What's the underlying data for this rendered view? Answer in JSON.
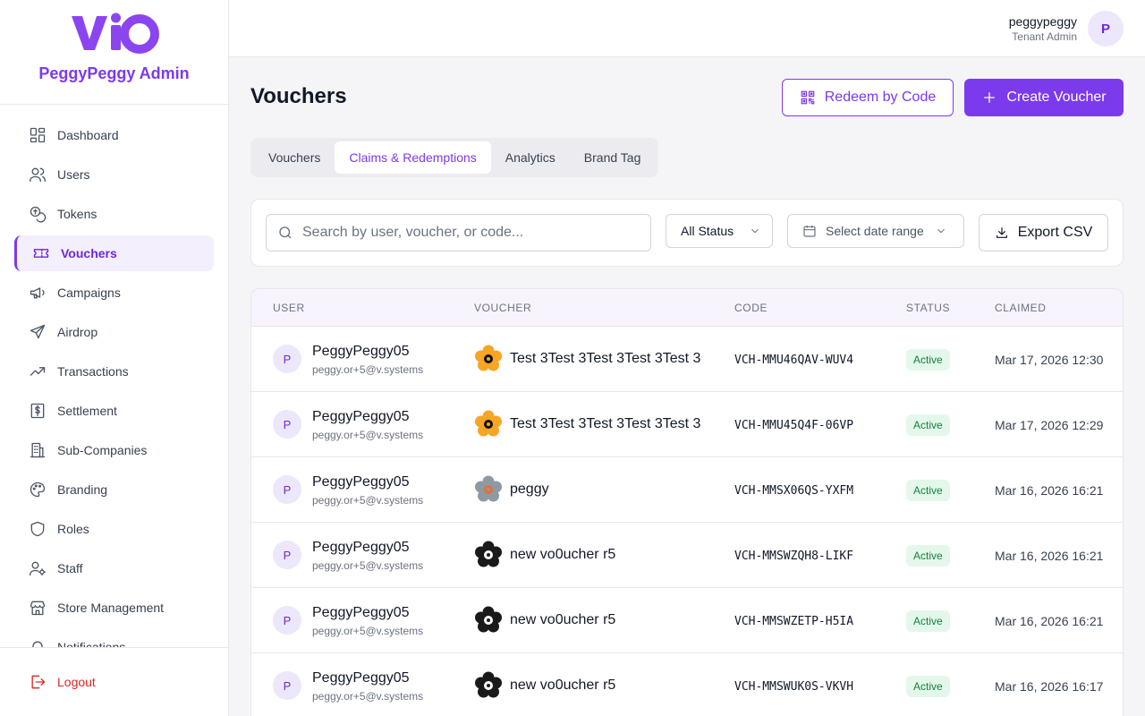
{
  "brand": {
    "logo_text": "VIO",
    "name": "PeggyPeggy Admin",
    "accent": "#7c3aed"
  },
  "nav": [
    {
      "label": "Dashboard",
      "icon": "dashboard-icon",
      "active": false
    },
    {
      "label": "Users",
      "icon": "users-icon",
      "active": false
    },
    {
      "label": "Tokens",
      "icon": "tokens-icon",
      "active": false
    },
    {
      "label": "Vouchers",
      "icon": "ticket-icon",
      "active": true
    },
    {
      "label": "Campaigns",
      "icon": "megaphone-icon",
      "active": false
    },
    {
      "label": "Airdrop",
      "icon": "send-icon",
      "active": false
    },
    {
      "label": "Transactions",
      "icon": "trending-up-icon",
      "active": false
    },
    {
      "label": "Settlement",
      "icon": "dollar-receipt-icon",
      "active": false
    },
    {
      "label": "Sub-Companies",
      "icon": "building-icon",
      "active": false
    },
    {
      "label": "Branding",
      "icon": "palette-icon",
      "active": false
    },
    {
      "label": "Roles",
      "icon": "shield-icon",
      "active": false
    },
    {
      "label": "Staff",
      "icon": "user-cog-icon",
      "active": false
    },
    {
      "label": "Store Management",
      "icon": "store-icon",
      "active": false
    },
    {
      "label": "Notifications",
      "icon": "bell-icon",
      "active": false
    }
  ],
  "logout_label": "Logout",
  "topbar": {
    "user_name": "peggypeggy",
    "user_role": "Tenant Admin",
    "avatar_initial": "P"
  },
  "page": {
    "title": "Vouchers",
    "redeem_label": "Redeem by Code",
    "create_label": "Create Voucher"
  },
  "tabs": [
    {
      "label": "Vouchers",
      "active": false
    },
    {
      "label": "Claims & Redemptions",
      "active": true
    },
    {
      "label": "Analytics",
      "active": false
    },
    {
      "label": "Brand Tag",
      "active": false
    }
  ],
  "filters": {
    "search_placeholder": "Search by user, voucher, or code...",
    "status_value": "All Status",
    "date_placeholder": "Select date range",
    "export_label": "Export CSV"
  },
  "table": {
    "columns": [
      "USER",
      "VOUCHER",
      "CODE",
      "STATUS",
      "CLAIMED"
    ],
    "rows": [
      {
        "initial": "P",
        "name": "PeggyPeggy05",
        "email": "peggy.or+5@v.systems",
        "voucher": "Test 3Test 3Test 3Test 3Test 3",
        "voucher_icon": "orange-flower",
        "code": "VCH-MMU46QAV-WUV4",
        "status": "Active",
        "claimed": "Mar 17, 2026 12:30"
      },
      {
        "initial": "P",
        "name": "PeggyPeggy05",
        "email": "peggy.or+5@v.systems",
        "voucher": "Test 3Test 3Test 3Test 3Test 3",
        "voucher_icon": "orange-flower",
        "code": "VCH-MMU45Q4F-06VP",
        "status": "Active",
        "claimed": "Mar 17, 2026 12:29"
      },
      {
        "initial": "P",
        "name": "PeggyPeggy05",
        "email": "peggy.or+5@v.systems",
        "voucher": "peggy",
        "voucher_icon": "gray-flower",
        "code": "VCH-MMSX06QS-YXFM",
        "status": "Active",
        "claimed": "Mar 16, 2026 16:21"
      },
      {
        "initial": "P",
        "name": "PeggyPeggy05",
        "email": "peggy.or+5@v.systems",
        "voucher": "new vo0ucher r5",
        "voucher_icon": "black-flower",
        "code": "VCH-MMSWZQH8-LIKF",
        "status": "Active",
        "claimed": "Mar 16, 2026 16:21"
      },
      {
        "initial": "P",
        "name": "PeggyPeggy05",
        "email": "peggy.or+5@v.systems",
        "voucher": "new vo0ucher r5",
        "voucher_icon": "black-flower",
        "code": "VCH-MMSWZETP-H5IA",
        "status": "Active",
        "claimed": "Mar 16, 2026 16:21"
      },
      {
        "initial": "P",
        "name": "PeggyPeggy05",
        "email": "peggy.or+5@v.systems",
        "voucher": "new vo0ucher r5",
        "voucher_icon": "black-flower",
        "code": "VCH-MMSWUK0S-VKVH",
        "status": "Active",
        "claimed": "Mar 16, 2026 16:17"
      }
    ]
  }
}
